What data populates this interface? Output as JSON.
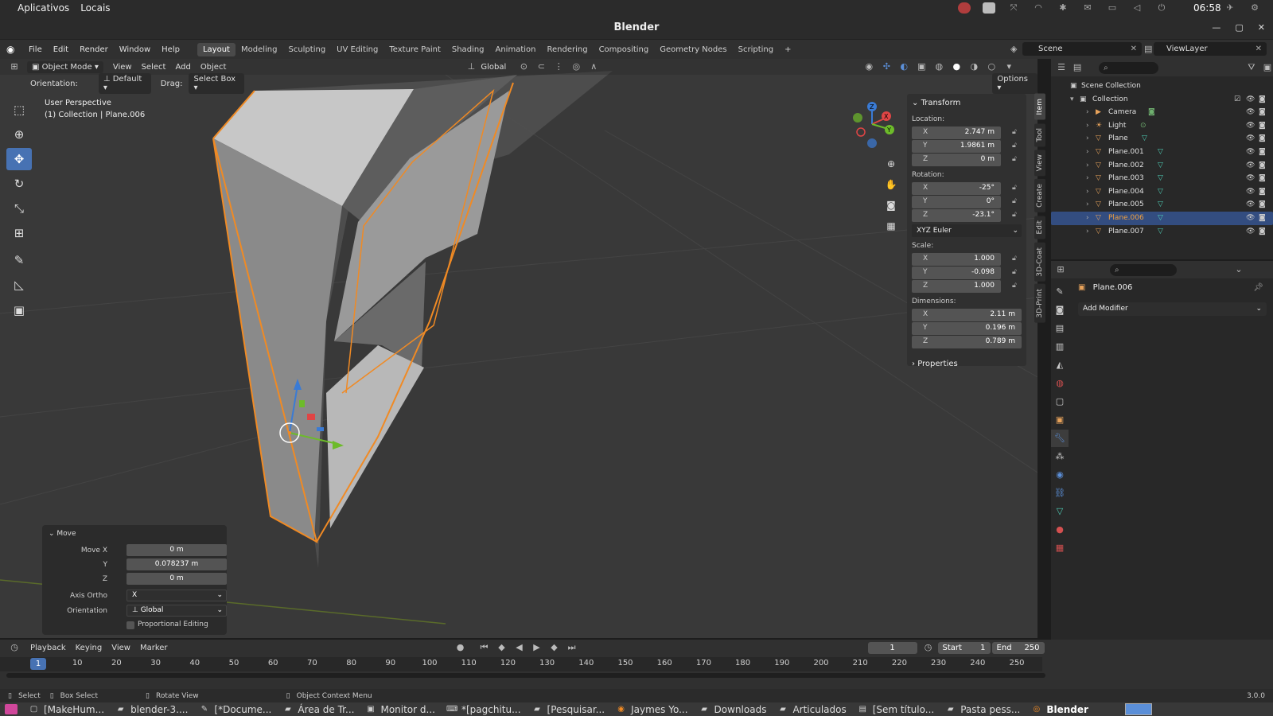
{
  "os": {
    "menu": [
      "Aplicativos",
      "Locais"
    ],
    "clock": "06:58"
  },
  "window": {
    "title": "Blender"
  },
  "menubar": [
    "File",
    "Edit",
    "Render",
    "Window",
    "Help"
  ],
  "workspaces": [
    "Layout",
    "Modeling",
    "Sculpting",
    "UV Editing",
    "Texture Paint",
    "Shading",
    "Animation",
    "Rendering",
    "Compositing",
    "Geometry Nodes",
    "Scripting"
  ],
  "active_workspace": "Layout",
  "scene": "Scene",
  "view_layer": "ViewLayer",
  "viewport_header": {
    "mode": "Object Mode",
    "menus": [
      "View",
      "Select",
      "Add",
      "Object"
    ],
    "transform_orientation": "Global",
    "options_label": "Options"
  },
  "tool_settings": {
    "orientation_label": "Orientation:",
    "orientation_value": "Default",
    "drag_label": "Drag:",
    "drag_value": "Select Box"
  },
  "viewport_info": {
    "perspective": "User Perspective",
    "collection": "(1) Collection | Plane.006"
  },
  "npanel": {
    "section_transform": "Transform",
    "location_label": "Location:",
    "location": [
      {
        "axis": "X",
        "value": "2.747 m"
      },
      {
        "axis": "Y",
        "value": "1.9861 m"
      },
      {
        "axis": "Z",
        "value": "0 m"
      }
    ],
    "rotation_label": "Rotation:",
    "rotation": [
      {
        "axis": "X",
        "value": "-25°"
      },
      {
        "axis": "Y",
        "value": "0°"
      },
      {
        "axis": "Z",
        "value": "-23.1°"
      }
    ],
    "rotation_mode": "XYZ Euler",
    "scale_label": "Scale:",
    "scale": [
      {
        "axis": "X",
        "value": "1.000"
      },
      {
        "axis": "Y",
        "value": "-0.098"
      },
      {
        "axis": "Z",
        "value": "1.000"
      }
    ],
    "dimensions_label": "Dimensions:",
    "dimensions": [
      {
        "axis": "X",
        "value": "2.11 m"
      },
      {
        "axis": "Y",
        "value": "0.196 m"
      },
      {
        "axis": "Z",
        "value": "0.789 m"
      }
    ],
    "section_properties": "Properties",
    "tabs": [
      "Item",
      "Tool",
      "View",
      "Create",
      "Edit",
      "3D-Coat",
      "3D-Print"
    ]
  },
  "move_panel": {
    "title": "Move",
    "move_x_label": "Move X",
    "move_x": "0 m",
    "y_label": "Y",
    "y": "0.078237 m",
    "z_label": "Z",
    "z": "0 m",
    "axis_ortho_label": "Axis Ortho",
    "axis_ortho": "X",
    "orientation_label": "Orientation",
    "orientation": "Global",
    "proportional": "Proportional Editing"
  },
  "outliner": {
    "scene_collection": "Scene Collection",
    "collection": "Collection",
    "items": [
      {
        "name": "Camera",
        "type": "camera"
      },
      {
        "name": "Light",
        "type": "light"
      },
      {
        "name": "Plane",
        "type": "mesh"
      },
      {
        "name": "Plane.001",
        "type": "mesh"
      },
      {
        "name": "Plane.002",
        "type": "mesh"
      },
      {
        "name": "Plane.003",
        "type": "mesh"
      },
      {
        "name": "Plane.004",
        "type": "mesh"
      },
      {
        "name": "Plane.005",
        "type": "mesh"
      },
      {
        "name": "Plane.006",
        "type": "mesh",
        "selected": true
      },
      {
        "name": "Plane.007",
        "type": "mesh"
      }
    ]
  },
  "properties": {
    "object_name": "Plane.006",
    "add_modifier": "Add Modifier"
  },
  "timeline": {
    "menus": [
      "Playback",
      "Keying",
      "View",
      "Marker"
    ],
    "current_frame": "1",
    "start_label": "Start",
    "start": "1",
    "end_label": "End",
    "end": "250",
    "ticks": [
      "10",
      "20",
      "30",
      "40",
      "50",
      "60",
      "70",
      "80",
      "90",
      "100",
      "110",
      "120",
      "130",
      "140",
      "150",
      "160",
      "170",
      "180",
      "190",
      "200",
      "210",
      "220",
      "230",
      "240",
      "250"
    ]
  },
  "statusbar": {
    "select": "Select",
    "box_select": "Box Select",
    "rotate_view": "Rotate View",
    "context_menu": "Object Context Menu",
    "version": "3.0.0"
  },
  "taskbar": [
    {
      "label": "[MakeHum...",
      "icon": "window-icon"
    },
    {
      "label": "blender-3....",
      "icon": "folder-icon"
    },
    {
      "label": "[*Docume...",
      "icon": "editor-icon"
    },
    {
      "label": "Área de Tr...",
      "icon": "folder-icon"
    },
    {
      "label": "Monitor d...",
      "icon": "monitor-icon"
    },
    {
      "label": "*[pagchitu...",
      "icon": "terminal-icon"
    },
    {
      "label": "[Pesquisar...",
      "icon": "folder-icon"
    },
    {
      "label": "Jaymes Yo...",
      "icon": "firefox-icon"
    },
    {
      "label": "Downloads",
      "icon": "folder-icon"
    },
    {
      "label": "Articulados",
      "icon": "folder-icon"
    },
    {
      "label": "[Sem título...",
      "icon": "document-icon"
    },
    {
      "label": "Pasta pess...",
      "icon": "folder-icon"
    },
    {
      "label": "Blender",
      "icon": "blender-icon",
      "active": true
    }
  ]
}
